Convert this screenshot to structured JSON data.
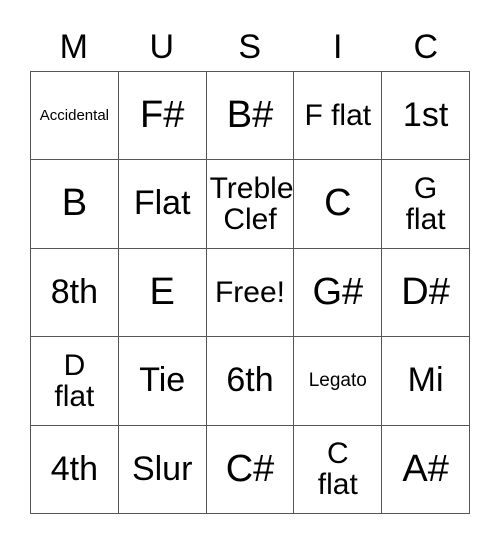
{
  "card": {
    "title_letters": [
      "M",
      "U",
      "S",
      "I",
      "C"
    ],
    "rows": [
      [
        {
          "text": "Accidental",
          "size": "xs",
          "multiline": false
        },
        {
          "text": "F#",
          "size": "xl",
          "multiline": false
        },
        {
          "text": "B#",
          "size": "xl",
          "multiline": false
        },
        {
          "text": "F flat",
          "size": "md",
          "multiline": false
        },
        {
          "text": "1st",
          "size": "lg",
          "multiline": false
        }
      ],
      [
        {
          "text": "B",
          "size": "xl",
          "multiline": false
        },
        {
          "text": "Flat",
          "size": "lg",
          "multiline": false
        },
        {
          "text": "Treble\nClef",
          "size": "md",
          "multiline": true
        },
        {
          "text": "C",
          "size": "xl",
          "multiline": false
        },
        {
          "text": "G\nflat",
          "size": "md",
          "multiline": true
        }
      ],
      [
        {
          "text": "8th",
          "size": "lg",
          "multiline": false
        },
        {
          "text": "E",
          "size": "xl",
          "multiline": false
        },
        {
          "text": "Free!",
          "size": "md",
          "multiline": false
        },
        {
          "text": "G#",
          "size": "xl",
          "multiline": false
        },
        {
          "text": "D#",
          "size": "xl",
          "multiline": false
        }
      ],
      [
        {
          "text": "D\nflat",
          "size": "md",
          "multiline": true
        },
        {
          "text": "Tie",
          "size": "lg",
          "multiline": false
        },
        {
          "text": "6th",
          "size": "lg",
          "multiline": false
        },
        {
          "text": "Legato",
          "size": "sm",
          "multiline": false
        },
        {
          "text": "Mi",
          "size": "lg",
          "multiline": false
        }
      ],
      [
        {
          "text": "4th",
          "size": "lg",
          "multiline": false
        },
        {
          "text": "Slur",
          "size": "lg",
          "multiline": false
        },
        {
          "text": "C#",
          "size": "xl",
          "multiline": false
        },
        {
          "text": "C\nflat",
          "size": "md",
          "multiline": true
        },
        {
          "text": "A#",
          "size": "xl",
          "multiline": false
        }
      ]
    ],
    "colors": {
      "background": "#ffffff",
      "text": "#000000",
      "grid_line": "#555555"
    }
  }
}
